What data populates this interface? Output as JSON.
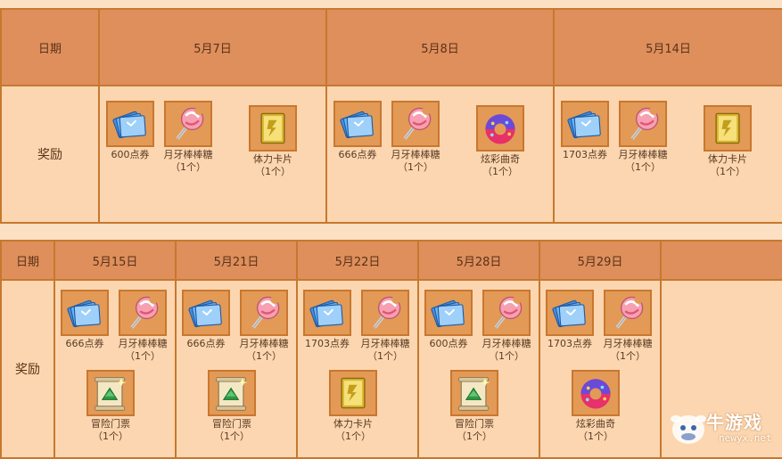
{
  "labels": {
    "date": "日期",
    "reward": "奖励"
  },
  "items": {
    "ticket600": {
      "name": "600点券",
      "icon": "ticket-icon"
    },
    "ticket666": {
      "name": "666点券",
      "icon": "ticket-icon"
    },
    "ticket1703": {
      "name": "1703点券",
      "icon": "ticket-icon"
    },
    "candy": {
      "name": "月牙棒棒糖",
      "count": "（1个）",
      "icon": "candy-icon"
    },
    "card": {
      "name": "体力卡片",
      "count": "（1个）",
      "icon": "card-icon"
    },
    "donut": {
      "name": "炫彩曲奇",
      "count": "（1个）",
      "icon": "donut-icon"
    },
    "scroll": {
      "name": "冒险门票",
      "count": "（1个）",
      "icon": "scroll-icon"
    }
  },
  "row1": {
    "dates": [
      "5月7日",
      "5月8日",
      "5月14日"
    ]
  },
  "row2": {
    "dates": [
      "5月15日",
      "5月21日",
      "5月22日",
      "5月28日",
      "5月29日"
    ]
  },
  "watermark": {
    "brand": "牛游戏",
    "url": "newyx.net"
  }
}
